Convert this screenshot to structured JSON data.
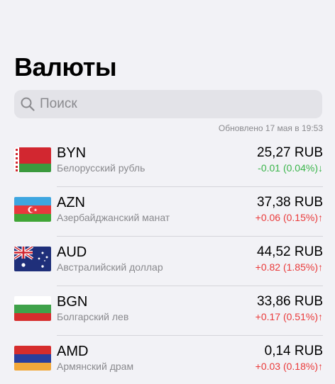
{
  "page_title": "Валюты",
  "search": {
    "placeholder": "Поиск",
    "icon": "search-icon"
  },
  "updated_text": "Обновлено 17 мая в 19:53",
  "colors": {
    "up": "#ea3a3a",
    "down": "#3ab54a",
    "secondary": "#8a8a8e"
  },
  "currencies": [
    {
      "code": "BYN",
      "name": "Белорусский рубль",
      "value": "25,27 RUB",
      "change": "-0.01 (0.04%)↓",
      "direction": "down",
      "flag": "belarus-flag"
    },
    {
      "code": "AZN",
      "name": "Азербайджанский манат",
      "value": "37,38 RUB",
      "change": "+0.06 (0.15%)↑",
      "direction": "up",
      "flag": "azerbaijan-flag"
    },
    {
      "code": "AUD",
      "name": "Австралийский доллар",
      "value": "44,52 RUB",
      "change": "+0.82 (1.85%)↑",
      "direction": "up",
      "flag": "australia-flag"
    },
    {
      "code": "BGN",
      "name": "Болгарский лев",
      "value": "33,86 RUB",
      "change": "+0.17 (0.51%)↑",
      "direction": "up",
      "flag": "bulgaria-flag"
    },
    {
      "code": "AMD",
      "name": "Армянский драм",
      "value": "0,14 RUB",
      "change": "+0.03 (0.18%)↑",
      "direction": "up",
      "flag": "armenia-flag"
    }
  ]
}
